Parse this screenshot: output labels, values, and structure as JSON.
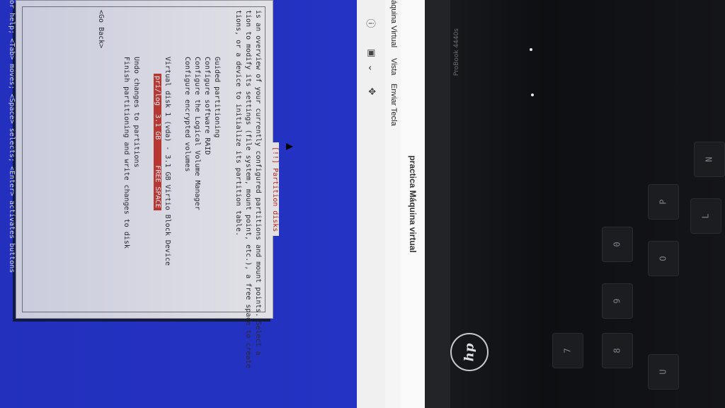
{
  "window": {
    "title": "practica Máquina virtual",
    "menu": [
      "áquina Virtual",
      "Vista",
      "Enviar Tecla"
    ]
  },
  "toolbar": {
    "icons": [
      "info-icon",
      "monitor-icon",
      "chevron-down-icon",
      "move-icon"
    ]
  },
  "dialog": {
    "title": "[!!] Partition disks",
    "intro": [
      "is an overview of your currently configured partitions and mount points. Select a",
      "tion to modify its settings (file system, mount point, etc.), a free space to create",
      "tions, or a device to initialize its partition table."
    ],
    "options": [
      "Guided partitioning",
      "Configure software RAID",
      "Configure the Logical Volume Manager",
      "Configure encrypted volumes"
    ],
    "disk": {
      "label": "Virtual disk 1 (vda) - 3.1 GB Virtio Block Device",
      "selected_row": "pri/log  3.1 GB      FREE SPACE"
    },
    "actions": [
      "Undo changes to partitions",
      "Finish partitioning and write changes to disk"
    ],
    "back_button": "<Go Back>"
  },
  "help_line": "or help; <Tab> moves; <Space> selects; <Enter> activates buttons",
  "laptop": {
    "brand": "hp",
    "model": "ProBook 4440s",
    "keys": [
      "8",
      "9",
      "0",
      "P",
      "O",
      "L",
      "U",
      "7",
      "N"
    ]
  }
}
